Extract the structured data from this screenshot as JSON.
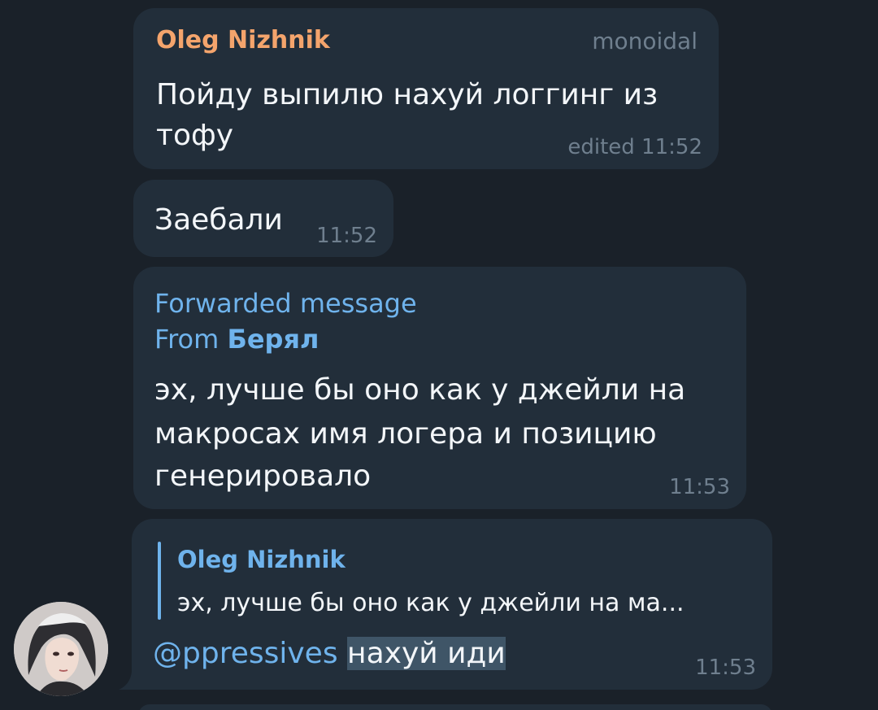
{
  "messages": [
    {
      "sender": "Oleg Nizhnik",
      "sender_color": "#f4a46c",
      "tag": "monoidal",
      "text_lines": [
        "Пойду выпилю нахуй логгинг из",
        "тофу"
      ],
      "meta": "edited 11:52"
    },
    {
      "text": "Заебали",
      "time": "11:52"
    },
    {
      "forwarded_label": "Forwarded message",
      "from_prefix": "From ",
      "from_name": "Берял",
      "text_lines": [
        "эх, лучше бы оно как у джейли на",
        "макросах имя логера и позицию",
        "генерировало"
      ],
      "time": "11:53"
    },
    {
      "reply": {
        "sender": "Oleg Nizhnik",
        "preview": "эх, лучше бы оно как у джейли на ма..."
      },
      "mention": "@ppressives",
      "text": "нахуй иди",
      "time": "11:53"
    }
  ]
}
